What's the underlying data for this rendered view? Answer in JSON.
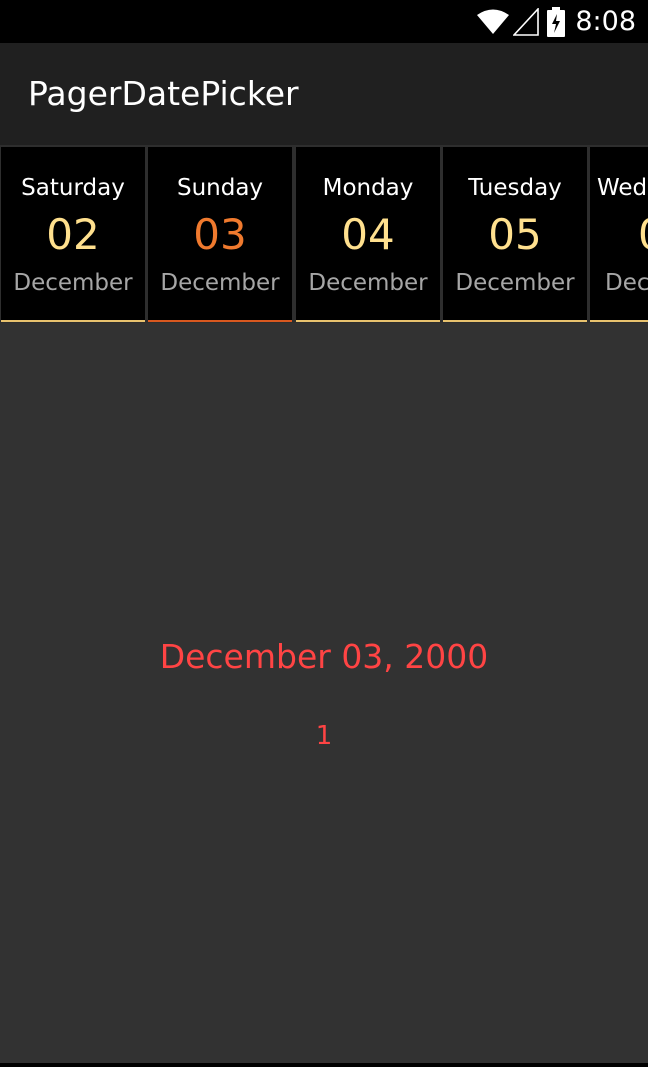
{
  "status_bar": {
    "time": "8:08",
    "icons": [
      "wifi-icon",
      "signal-icon",
      "battery-charging-icon"
    ]
  },
  "action_bar": {
    "title": "PagerDatePicker"
  },
  "pager": {
    "days": [
      {
        "day_name": "Saturday",
        "day_number": "02",
        "month": "December",
        "selected": false
      },
      {
        "day_name": "Sunday",
        "day_number": "03",
        "month": "December",
        "selected": true
      },
      {
        "day_name": "Monday",
        "day_number": "04",
        "month": "December",
        "selected": false
      },
      {
        "day_name": "Tuesday",
        "day_number": "05",
        "month": "December",
        "selected": false
      },
      {
        "day_name": "Wed",
        "day_number": "0",
        "month": "Dec",
        "selected": false
      }
    ]
  },
  "content": {
    "selected_date": "December 03, 2000",
    "page_index": "1"
  },
  "colors": {
    "day_number": "#ffe08e",
    "selected_day_number": "#f07a2e",
    "selected_underline": "#d9581f",
    "underline": "#e8c26e",
    "content_text": "#ff4444"
  }
}
